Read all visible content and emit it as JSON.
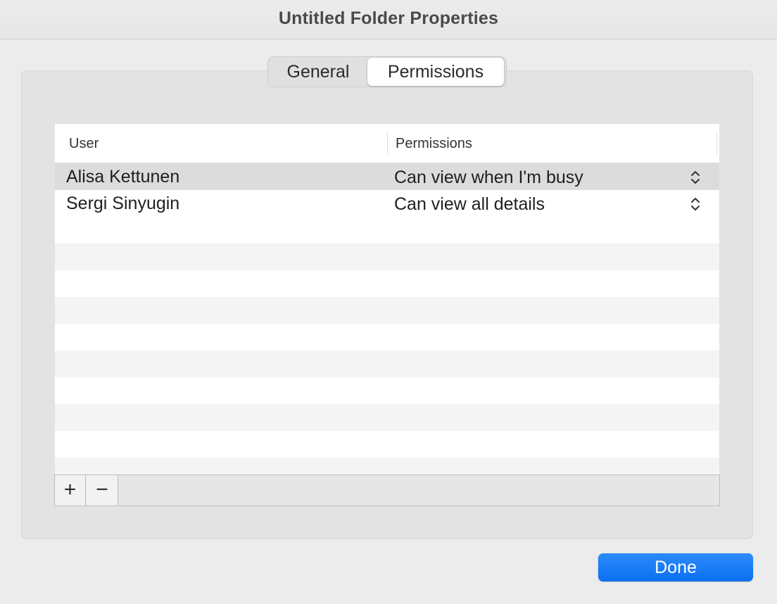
{
  "window": {
    "title": "Untitled Folder Properties"
  },
  "tabs": [
    {
      "label": "General",
      "selected": false
    },
    {
      "label": "Permissions",
      "selected": true
    }
  ],
  "table": {
    "columns": {
      "user": "User",
      "permissions": "Permissions"
    },
    "rows": [
      {
        "user": "Alisa Kettunen",
        "permission": "Can view when I'm busy",
        "selected": true
      },
      {
        "user": "Sergi Sinyugin",
        "permission": "Can view all details",
        "selected": false
      }
    ]
  },
  "toolbar": {
    "add_label": "+",
    "remove_label": "−"
  },
  "footer": {
    "done_label": "Done"
  },
  "colors": {
    "accent": "#1a7cf5",
    "selected_row": "#dcdcdc",
    "alt_row": "#f4f4f4"
  },
  "icons": {
    "row_stepper": "up-down-chevron-icon"
  }
}
